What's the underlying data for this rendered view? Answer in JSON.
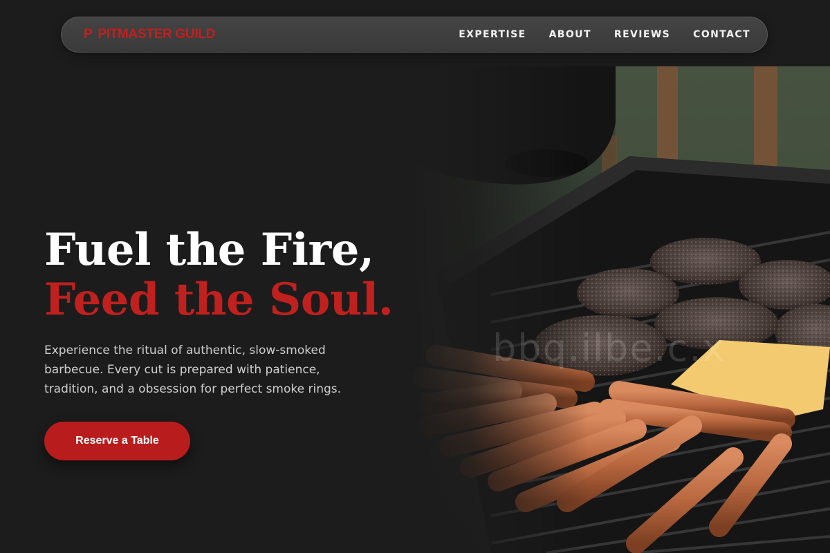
{
  "brand": {
    "logo_icon": "flame-icon",
    "name": "PITMASTER GUILD",
    "accent_color": "#c0201e"
  },
  "nav": {
    "items": [
      {
        "label": "EXPERTISE"
      },
      {
        "label": "ABOUT"
      },
      {
        "label": "REVIEWS"
      },
      {
        "label": "CONTACT"
      }
    ]
  },
  "hero": {
    "title_line1": "Fuel the Fire,",
    "title_line2": "Feed the Soul.",
    "description": "Experience the ritual of authentic, slow-smoked barbecue. Every cut is prepared with patience, tradition, and a obsession for perfect smoke rings.",
    "cta_label": "Reserve a Table",
    "image_alt": "grill-with-burgers-and-hot-dogs-photo",
    "watermark": "bbq.ilbe.c.x"
  }
}
